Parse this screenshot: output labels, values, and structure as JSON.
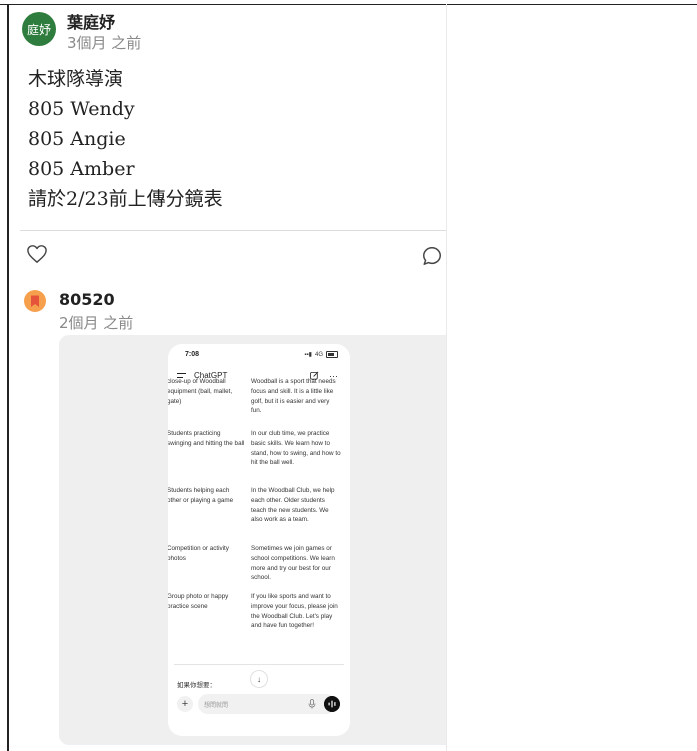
{
  "post1": {
    "avatar_text": "庭妤",
    "author": "葉庭妤",
    "time": "3個月 之前",
    "lines": [
      "木球隊導演",
      "805 Wendy",
      "805 Angie",
      "805 Amber",
      "請於2/23前上傳分鏡表"
    ]
  },
  "post2": {
    "author": "80520",
    "time": "2個月 之前"
  },
  "phone": {
    "time": "7:08",
    "network": "4G",
    "title": "ChatGPT",
    "more": "···",
    "rows": [
      {
        "c1": "close-up of Woodball equipment (ball, mallet, gate)",
        "c2": "Woodball is a sport that needs focus and skill. It is a little like golf, but it is easier and very fun."
      },
      {
        "c1": "Students practicing swinging and hitting the ball",
        "c2": "In our club time, we practice basic skills. We learn how to stand, how to swing, and how to hit the ball well."
      },
      {
        "c1": "Students helping each other or playing a game",
        "c2": "In the Woodball Club, we help each other. Older students teach the new students. We also work as a team."
      },
      {
        "c1": "Competition or activity photos",
        "c2": "Sometimes we join games or school competitions. We learn more and try our best for our school."
      },
      {
        "c1": "Group photo or happy practice scene",
        "c2": "If you like sports and want to improve your focus, please join the Woodball Club. Let's play and have fun together!"
      }
    ],
    "prompt_label": "如果你想要：",
    "down_arrow": "↓",
    "plus": "+",
    "input_placeholder": "想問就問"
  }
}
